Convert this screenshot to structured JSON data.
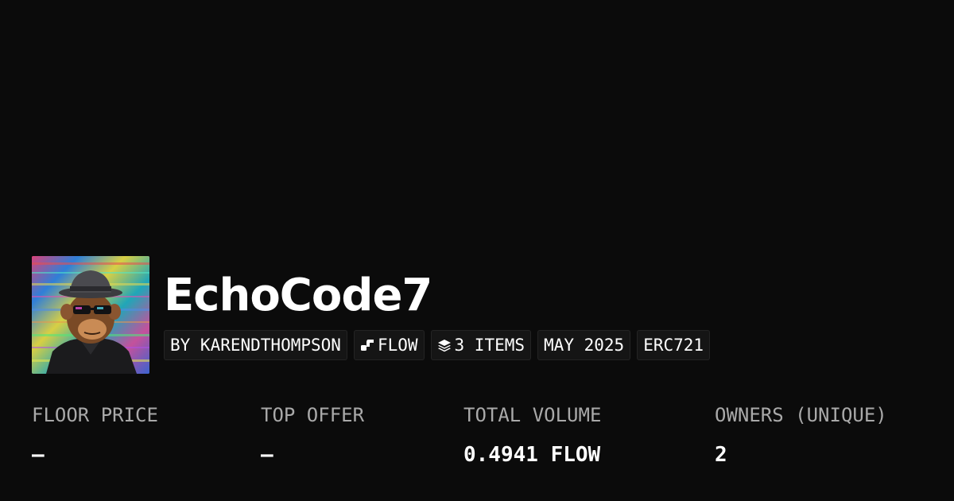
{
  "collection": {
    "name": "EchoCode7",
    "avatar_icon": "ape-avatar-image",
    "tags": {
      "creator": "BY KARENDTHOMPSON",
      "chain": "FLOW",
      "chain_icon": "flow-logo-icon",
      "items": "3 ITEMS",
      "items_icon": "layers-icon",
      "date": "MAY 2025",
      "standard": "ERC721"
    }
  },
  "stats": {
    "floor_price": {
      "label": "FLOOR PRICE",
      "value": "—"
    },
    "top_offer": {
      "label": "TOP OFFER",
      "value": "—"
    },
    "total_volume": {
      "label": "TOTAL VOLUME",
      "value": "0.4941 FLOW"
    },
    "owners": {
      "label": "OWNERS (UNIQUE)",
      "value": "2"
    }
  },
  "colors": {
    "background": "#0b0b0b",
    "tag_background": "#151515",
    "label": "#a9a9a9",
    "text": "#ffffff"
  }
}
